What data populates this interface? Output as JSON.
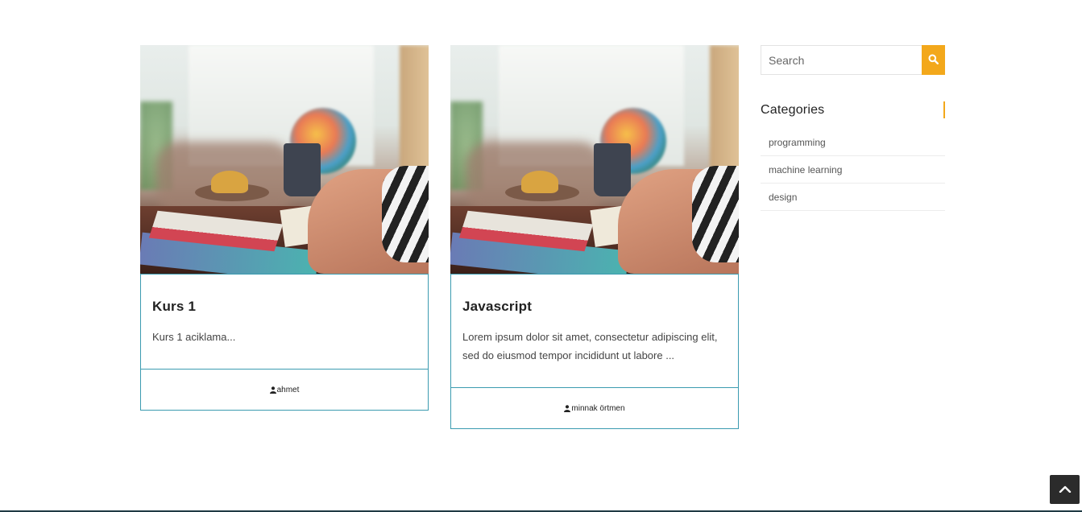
{
  "posts": [
    {
      "title": "Kurs 1",
      "excerpt": "Kurs 1 aciklama...",
      "author": "ahmet",
      "image_icon": "blog-post-photo"
    },
    {
      "title": "Javascript",
      "excerpt": "Lorem ipsum dolor sit amet, consectetur adipiscing elit, sed do eiusmod tempor incididunt ut labore ...",
      "author": "minnak örtmen",
      "image_icon": "blog-post-photo"
    }
  ],
  "sidebar": {
    "search": {
      "placeholder": "Search",
      "value": "",
      "button_icon": "search-icon"
    },
    "categories": {
      "title": "Categories",
      "items": [
        "programming",
        "machine learning",
        "design"
      ]
    }
  },
  "scroll_top_icon": "chevron-up-icon",
  "colors": {
    "accent": "#f3a81b",
    "card_border": "#3b9bb0",
    "scroll_button": "#2b2b2b"
  }
}
